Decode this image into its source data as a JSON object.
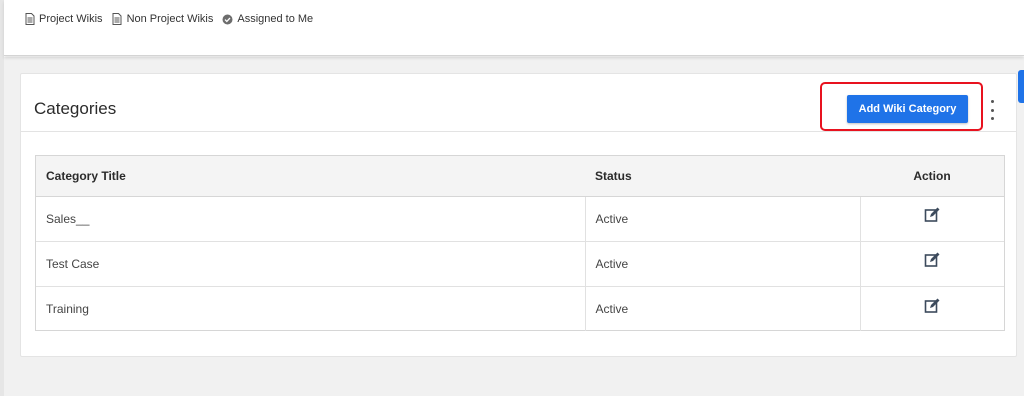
{
  "filters": [
    {
      "label": "Project Wikis",
      "icon": "document-icon"
    },
    {
      "label": "Non Project Wikis",
      "icon": "document-icon"
    },
    {
      "label": "Assigned to Me",
      "icon": "check-circle-icon"
    }
  ],
  "card": {
    "title": "Categories",
    "add_button_label": "Add Wiki Category",
    "menu_icon": "more-vertical-icon"
  },
  "table": {
    "columns": [
      "Category Title",
      "Status",
      "Action"
    ],
    "rows": [
      {
        "title": "Sales__",
        "status": "Active",
        "action_icon": "edit-icon"
      },
      {
        "title": "Test Case",
        "status": "Active",
        "action_icon": "edit-icon"
      },
      {
        "title": "Training",
        "status": "Active",
        "action_icon": "edit-icon"
      }
    ]
  },
  "colors": {
    "primary": "#1f73e8",
    "highlight_border": "#e8121f",
    "page_background": "#f1f1f1",
    "header_row": "#f4f4f4"
  }
}
